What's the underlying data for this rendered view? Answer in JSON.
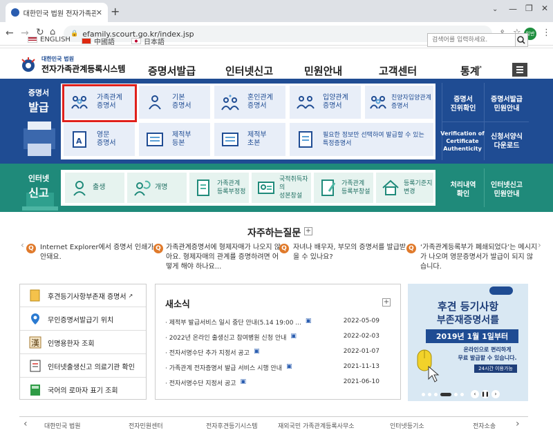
{
  "browser": {
    "tab_title": "대한민국 법원 전자가족관계등록",
    "url": "efamily.scourt.go.kr/index.jsp",
    "profile_label": "일반"
  },
  "languages": [
    "ENGLISH",
    "中國語",
    "日本語"
  ],
  "search": {
    "placeholder": "검색어를 입력하세요."
  },
  "site": {
    "logo_top": "대한민국 법원",
    "logo_main": "전자가족관계등록시스템"
  },
  "gnb": [
    "증명서발급",
    "인터넷신고",
    "민원안내",
    "고객센터",
    "통계"
  ],
  "cert_band": {
    "title_line1": "증명서",
    "title_line2": "발급",
    "items": [
      {
        "label1": "가족관계",
        "label2": "증명서",
        "icon": "family-icon"
      },
      {
        "label1": "기본",
        "label2": "증명서",
        "icon": "person-icon"
      },
      {
        "label1": "혼인관계",
        "label2": "증명서",
        "icon": "couple-icon"
      },
      {
        "label1": "입양관계",
        "label2": "증명서",
        "icon": "adoption-icon"
      },
      {
        "label1": "친양자입양관계",
        "label2": "증명서",
        "icon": "family-icon"
      },
      {
        "label1": "영문",
        "label2": "증명서",
        "icon": "english-doc-icon"
      },
      {
        "label1": "제적부",
        "label2": "등본",
        "icon": "register-icon"
      },
      {
        "label1": "제적부",
        "label2": "초본",
        "icon": "register-icon"
      },
      {
        "label1": "필요한 정보만 선택하여 발급할 수 있는",
        "label2": "특정증명서",
        "icon": "select-doc-icon"
      }
    ],
    "side_links": [
      {
        "label1": "증명서",
        "label2": "진위확인"
      },
      {
        "label1": "증명서발급",
        "label2": "민원안내"
      },
      {
        "label1": "Verification of",
        "label2": "Certificate",
        "label3": "Authenticity"
      },
      {
        "label1": "신청서양식",
        "label2": "다운로드"
      }
    ]
  },
  "net_band": {
    "title_line1": "인터넷",
    "title_line2": "신고",
    "items": [
      {
        "label1": "출생",
        "label2": ""
      },
      {
        "label1": "개명",
        "label2": ""
      },
      {
        "label1": "가족관계",
        "label2": "등록부정정"
      },
      {
        "label1": "국적취득자의",
        "label2": "성본창설"
      },
      {
        "label1": "가족관계",
        "label2": "등록부창설"
      },
      {
        "label1": "등록기준지",
        "label2": "변경"
      }
    ],
    "side_links": [
      {
        "label1": "처리내역",
        "label2": "확인"
      },
      {
        "label1": "인터넷신고",
        "label2": "민원안내"
      }
    ]
  },
  "faq": {
    "title": "자주하는질문",
    "items": [
      "Internet Explorer에서 증명서 인쇄가 안돼요.",
      "가족관계증명서에 형제자매가 나오지 않아요. 형제자매의 관계를 증명하려면 어떻게 해야 하나요...",
      "자녀나 배우자, 부모의 증명서를 발급받을 수 있나요?",
      "‘가족관계등록부가 폐쇄되었다’는 메시지가 나오며 영문증명서가 발급이 되지 않습니다."
    ]
  },
  "quick_links": [
    {
      "label": "후견등기사항부존재 증명서",
      "icon": "document-icon"
    },
    {
      "label": "무인증명서발급기 위치",
      "icon": "location-icon"
    },
    {
      "label": "인명용한자 조회",
      "icon": "hanja-icon"
    },
    {
      "label": "인터넷출생신고 의료기관 확인",
      "icon": "checklist-icon"
    },
    {
      "label": "국어의 로마자 표기 조회",
      "icon": "book-icon"
    }
  ],
  "news": {
    "title": "새소식",
    "items": [
      {
        "title": "제적부 발급서비스 일시 중단 안내(5.14 19:00 ...",
        "date": "2022-05-09"
      },
      {
        "title": "2022년 온라인 출생신고 참여병원 신청 안내",
        "date": "2022-02-03"
      },
      {
        "title": "전자서명수단 추가 지정서 공고",
        "date": "2022-01-07"
      },
      {
        "title": "가족관계 전자증명서 발급 서비스 시행 안내",
        "date": "2021-11-13"
      },
      {
        "title": "전자서명수단 지정서 공고",
        "date": "2021-06-10"
      }
    ]
  },
  "banner": {
    "line1": "후견 등기사항",
    "line2": "부존재증명서를",
    "line3": "2019년 1월 1일부터",
    "line4": "온라인으로 편리하게",
    "line5": "무료 발급할 수 있습니다.",
    "badge": "24시간 이용가능"
  },
  "footer": [
    "대한민국 법원",
    "전자민원센터",
    "전자후견등기시스템",
    "재외국민 가족관계등록사무소",
    "인터넷등기소",
    "전자소송"
  ],
  "colors": {
    "cert_band": "#1f4c93",
    "net_band": "#1f8a7a",
    "highlight": "#e0201b",
    "faq_badge": "#e07a2b"
  }
}
